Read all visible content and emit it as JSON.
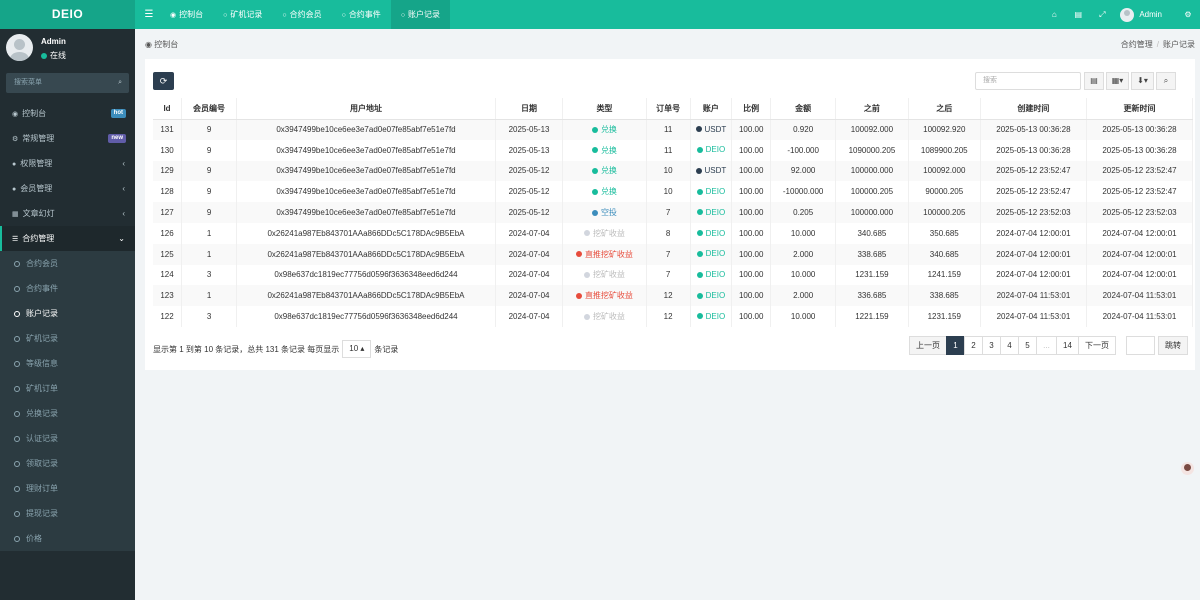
{
  "topbar": {
    "logo": "DEIO",
    "tabs": [
      {
        "icon": "dashboard-icon",
        "label": "控制台"
      },
      {
        "icon": "circle-icon",
        "label": "矿机记录"
      },
      {
        "icon": "circle-icon",
        "label": "合约会员"
      },
      {
        "icon": "circle-icon",
        "label": "合约事件"
      },
      {
        "icon": "circle-icon",
        "label": "账户记录"
      }
    ],
    "user": "Admin"
  },
  "sidebar": {
    "user_name": "Admin",
    "status": "在线",
    "search_placeholder": "搜索菜单",
    "menu": [
      {
        "icon": "dashboard-icon",
        "label": "控制台",
        "badge": "hot"
      },
      {
        "icon": "cogs-icon",
        "label": "常规管理",
        "badge": "new"
      },
      {
        "icon": "group-icon",
        "label": "权限管理"
      },
      {
        "icon": "user-icon",
        "label": "会员管理"
      },
      {
        "icon": "article-icon",
        "label": "文章幻灯"
      },
      {
        "icon": "list-icon",
        "label": "合约管理"
      }
    ],
    "submenu": [
      "合约会员",
      "合约事件",
      "账户记录",
      "矿机记录",
      "等级信息",
      "矿机订单",
      "兑换记录",
      "认证记录",
      "领取记录",
      "理财订单",
      "提现记录",
      "价格"
    ],
    "active_submenu": "账户记录"
  },
  "breadcrumb": {
    "left": "控制台",
    "items": [
      "合约管理",
      "账户记录"
    ]
  },
  "toolbar": {
    "search_placeholder": "搜索"
  },
  "table": {
    "headers": [
      "Id",
      "会员编号",
      "用户地址",
      "日期",
      "类型",
      "订单号",
      "账户",
      "比例",
      "金额",
      "之前",
      "之后",
      "创建时间",
      "更新时间"
    ],
    "rows": [
      {
        "id": "131",
        "member": "9",
        "address": "0x3947499be10ce6ee3e7ad0e07fe85abf7e51e7fd",
        "date": "2025-05-13",
        "type": "兑换",
        "type_color": "#18bc9c",
        "order": "11",
        "account": "USDT",
        "account_color": "#2c3e50",
        "ratio": "100.00",
        "amount": "0.920",
        "before": "100092.000",
        "after": "100092.920",
        "created": "2025-05-13 00:36:28",
        "updated": "2025-05-13 00:36:28"
      },
      {
        "id": "130",
        "member": "9",
        "address": "0x3947499be10ce6ee3e7ad0e07fe85abf7e51e7fd",
        "date": "2025-05-13",
        "type": "兑换",
        "type_color": "#18bc9c",
        "order": "11",
        "account": "DEIO",
        "account_color": "#18bc9c",
        "ratio": "100.00",
        "amount": "-100.000",
        "before": "1090000.205",
        "after": "1089900.205",
        "created": "2025-05-13 00:36:28",
        "updated": "2025-05-13 00:36:28"
      },
      {
        "id": "129",
        "member": "9",
        "address": "0x3947499be10ce6ee3e7ad0e07fe85abf7e51e7fd",
        "date": "2025-05-12",
        "type": "兑换",
        "type_color": "#18bc9c",
        "order": "10",
        "account": "USDT",
        "account_color": "#2c3e50",
        "ratio": "100.00",
        "amount": "92.000",
        "before": "100000.000",
        "after": "100092.000",
        "created": "2025-05-12 23:52:47",
        "updated": "2025-05-12 23:52:47"
      },
      {
        "id": "128",
        "member": "9",
        "address": "0x3947499be10ce6ee3e7ad0e07fe85abf7e51e7fd",
        "date": "2025-05-12",
        "type": "兑换",
        "type_color": "#18bc9c",
        "order": "10",
        "account": "DEIO",
        "account_color": "#18bc9c",
        "ratio": "100.00",
        "amount": "-10000.000",
        "before": "100000.205",
        "after": "90000.205",
        "created": "2025-05-12 23:52:47",
        "updated": "2025-05-12 23:52:47"
      },
      {
        "id": "127",
        "member": "9",
        "address": "0x3947499be10ce6ee3e7ad0e07fe85abf7e51e7fd",
        "date": "2025-05-12",
        "type": "空投",
        "type_color": "#3c8dbc",
        "order": "7",
        "account": "DEIO",
        "account_color": "#18bc9c",
        "ratio": "100.00",
        "amount": "0.205",
        "before": "100000.000",
        "after": "100000.205",
        "created": "2025-05-12 23:52:03",
        "updated": "2025-05-12 23:52:03"
      },
      {
        "id": "126",
        "member": "1",
        "address": "0x26241a987Eb843701AAa866DDc5C178DAc9B5EbA",
        "date": "2024-07-04",
        "type": "挖矿收益",
        "type_color": "#d2d6de",
        "order": "8",
        "account": "DEIO",
        "account_color": "#18bc9c",
        "ratio": "100.00",
        "amount": "10.000",
        "before": "340.685",
        "after": "350.685",
        "created": "2024-07-04 12:00:01",
        "updated": "2024-07-04 12:00:01"
      },
      {
        "id": "125",
        "member": "1",
        "address": "0x26241a987Eb843701AAa866DDc5C178DAc9B5EbA",
        "date": "2024-07-04",
        "type": "直推挖矿收益",
        "type_color": "#e74c3c",
        "order": "7",
        "account": "DEIO",
        "account_color": "#18bc9c",
        "ratio": "100.00",
        "amount": "2.000",
        "before": "338.685",
        "after": "340.685",
        "created": "2024-07-04 12:00:01",
        "updated": "2024-07-04 12:00:01"
      },
      {
        "id": "124",
        "member": "3",
        "address": "0x98e637dc1819ec77756d0596f3636348eed6d244",
        "date": "2024-07-04",
        "type": "挖矿收益",
        "type_color": "#d2d6de",
        "order": "7",
        "account": "DEIO",
        "account_color": "#18bc9c",
        "ratio": "100.00",
        "amount": "10.000",
        "before": "1231.159",
        "after": "1241.159",
        "created": "2024-07-04 12:00:01",
        "updated": "2024-07-04 12:00:01"
      },
      {
        "id": "123",
        "member": "1",
        "address": "0x26241a987Eb843701AAa866DDc5C178DAc9B5EbA",
        "date": "2024-07-04",
        "type": "直推挖矿收益",
        "type_color": "#e74c3c",
        "order": "12",
        "account": "DEIO",
        "account_color": "#18bc9c",
        "ratio": "100.00",
        "amount": "2.000",
        "before": "336.685",
        "after": "338.685",
        "created": "2024-07-04 11:53:01",
        "updated": "2024-07-04 11:53:01"
      },
      {
        "id": "122",
        "member": "3",
        "address": "0x98e637dc1819ec77756d0596f3636348eed6d244",
        "date": "2024-07-04",
        "type": "挖矿收益",
        "type_color": "#d2d6de",
        "order": "12",
        "account": "DEIO",
        "account_color": "#18bc9c",
        "ratio": "100.00",
        "amount": "10.000",
        "before": "1221.159",
        "after": "1231.159",
        "created": "2024-07-04 11:53:01",
        "updated": "2024-07-04 11:53:01"
      }
    ]
  },
  "pagination": {
    "info_prefix": "显示第 1 到第 10 条记录，总共 131 条记录 每页显示",
    "page_size": "10",
    "info_suffix": "条记录",
    "prev": "上一页",
    "pages": [
      "1",
      "2",
      "3",
      "4",
      "5",
      "...",
      "14"
    ],
    "active_page": "1",
    "next": "下一页",
    "jump": "跳转"
  },
  "colors": {
    "accent": "#18bc9c",
    "sidebar": "#222d32",
    "dark_button": "#2c3e50"
  }
}
